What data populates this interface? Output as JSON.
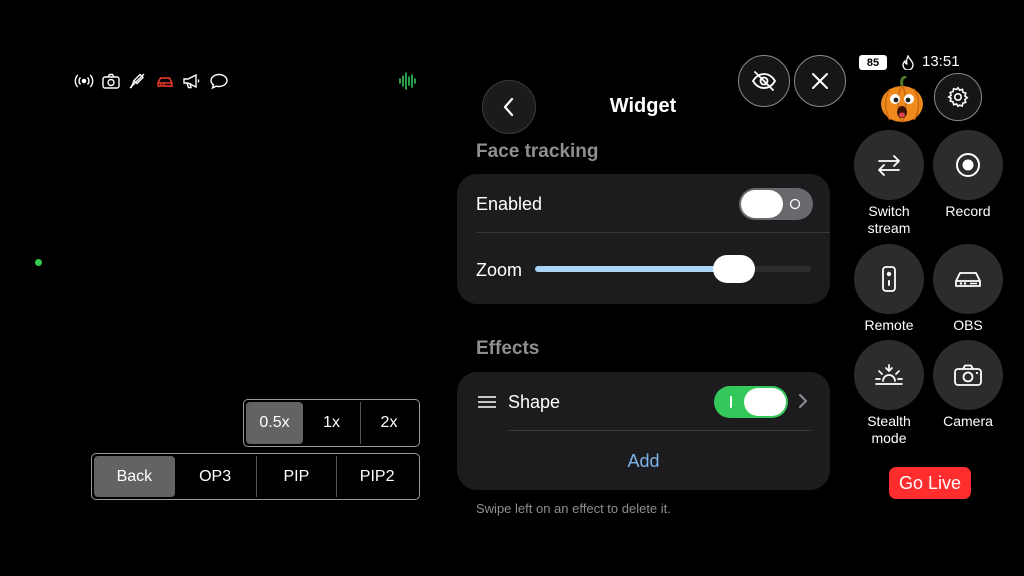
{
  "status_icons": [
    "broadcast-icon",
    "camera-icon",
    "mic-off-icon",
    "obs-icon",
    "megaphone-icon",
    "chat-icon"
  ],
  "colors": {
    "accent_green": "#34c759",
    "live_red": "#ff2d2d",
    "link_blue": "#79b4ea",
    "obs_red": "#ff3b30"
  },
  "zoom_presets": {
    "options": [
      "0.5x",
      "1x",
      "2x"
    ],
    "selected": "0.5x"
  },
  "scenes": {
    "options": [
      "Back",
      "OP3",
      "PIP",
      "PIP2"
    ],
    "selected": "Back"
  },
  "widget_panel": {
    "title": "Widget",
    "face_tracking": {
      "header": "Face tracking",
      "enabled_label": "Enabled",
      "enabled": false,
      "zoom_label": "Zoom",
      "zoom_level": 0.72
    },
    "effects": {
      "header": "Effects",
      "items": [
        {
          "label": "Shape",
          "enabled": true
        }
      ],
      "add_label": "Add"
    },
    "hint": "Swipe left on an effect to delete it."
  },
  "device_status": {
    "battery": "85",
    "time": "13:51"
  },
  "quick_buttons": [
    {
      "label": "Switch stream",
      "icon": "switch-arrows-icon"
    },
    {
      "label": "Record",
      "icon": "record-icon"
    },
    {
      "label": "Remote",
      "icon": "remote-icon"
    },
    {
      "label": "OBS",
      "icon": "obs-icon"
    },
    {
      "label": "Stealth mode",
      "icon": "sunset-icon"
    },
    {
      "label": "Camera",
      "icon": "camera-icon"
    }
  ],
  "go_live_label": "Go Live"
}
